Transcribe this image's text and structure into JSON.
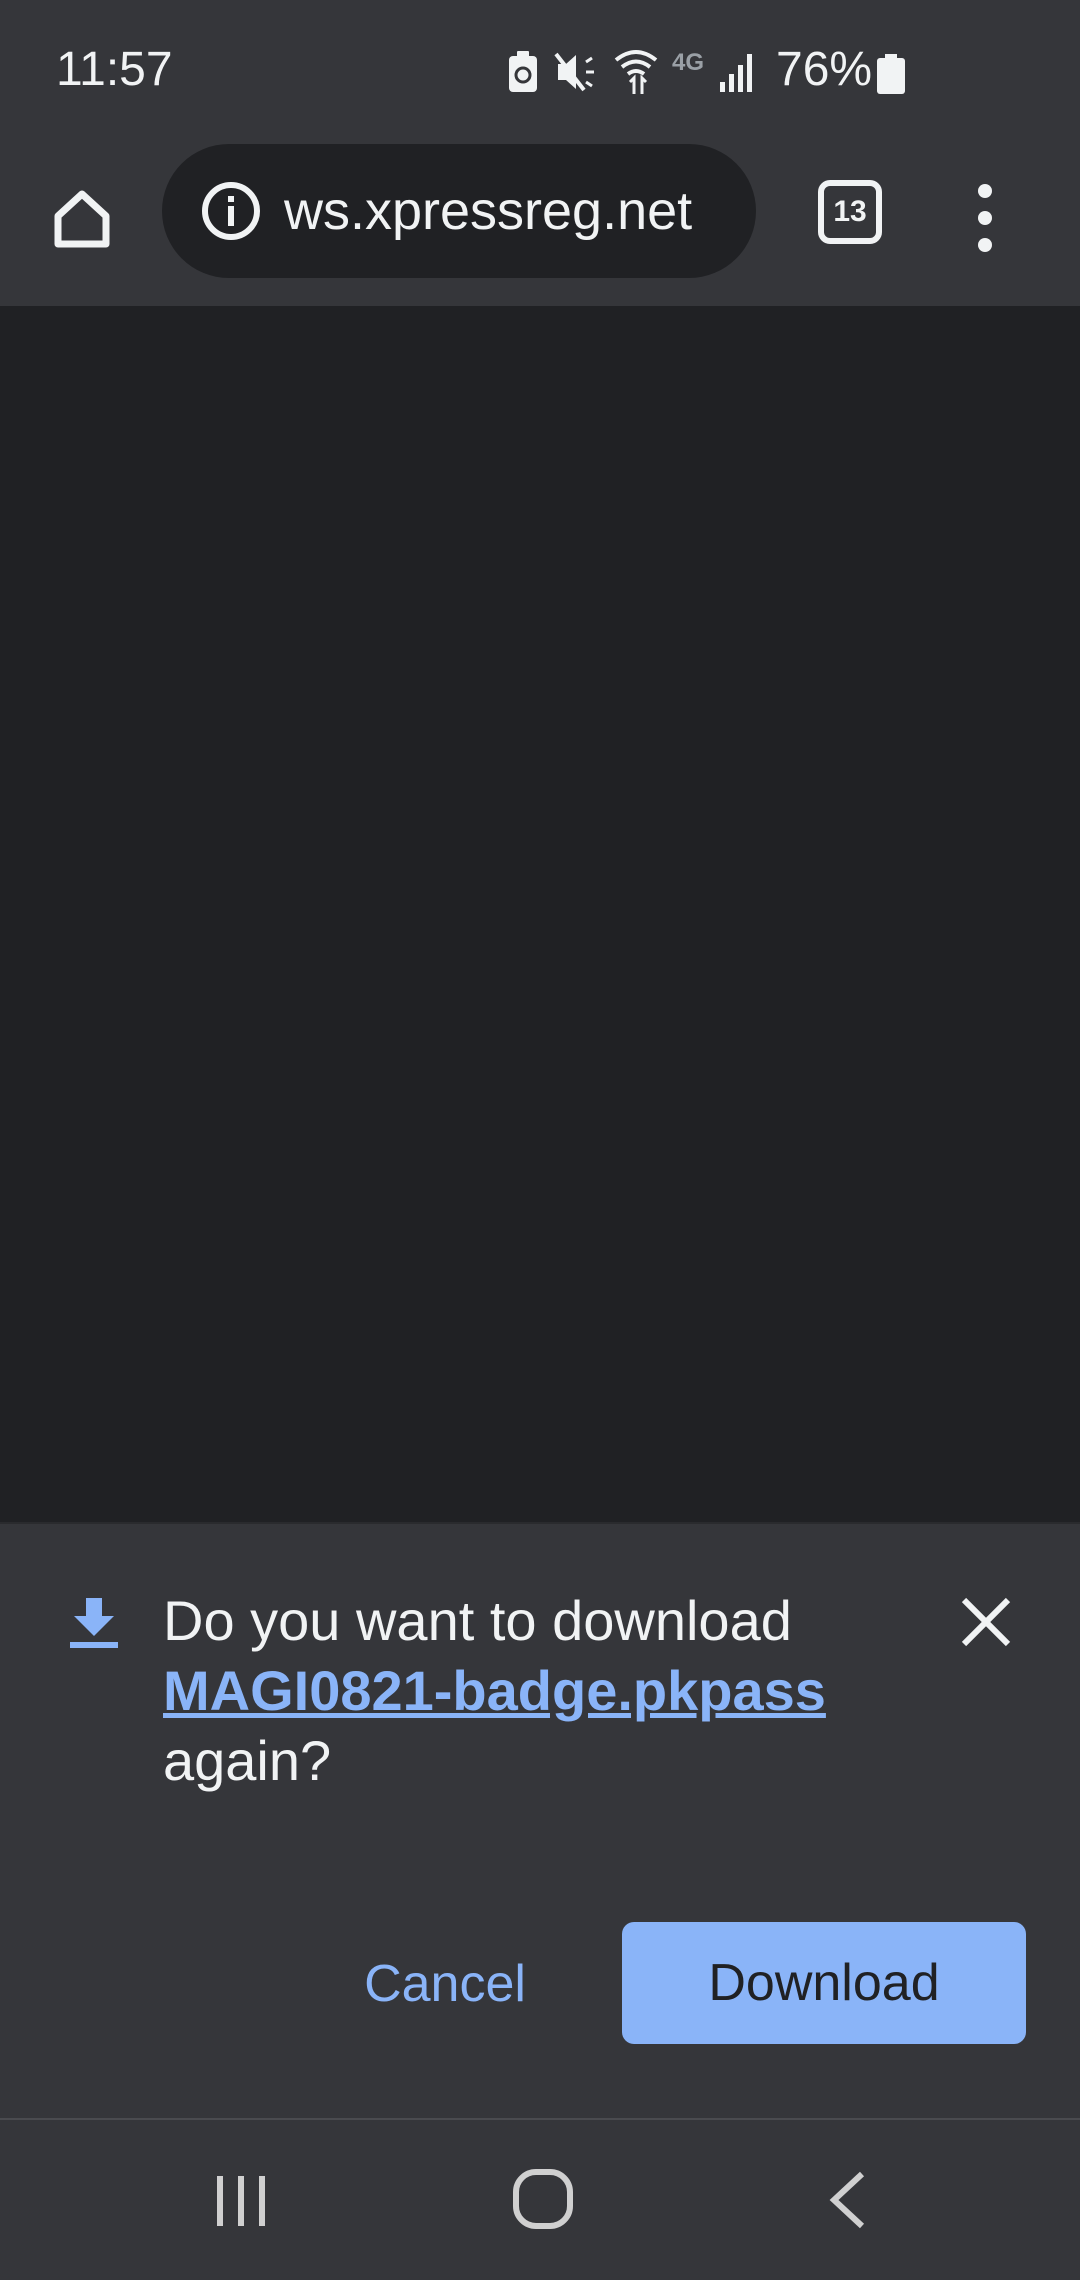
{
  "status_bar": {
    "time": "11:57",
    "network_label": "4G",
    "battery_percent": "76%",
    "icons": [
      "battery-saver-icon",
      "mute-icon",
      "wifi-icon",
      "4g-icon",
      "signal-icon",
      "battery-icon"
    ]
  },
  "toolbar": {
    "url": "ws.xpressreg.net",
    "tab_count": "13",
    "icons": [
      "home-icon",
      "info-icon",
      "tabs-icon",
      "more-menu-icon"
    ]
  },
  "download_prompt": {
    "message_prefix": "Do you want to download",
    "file_name": "MAGI0821-badge.pkpass",
    "message_suffix": "again?",
    "cancel_label": "Cancel",
    "download_label": "Download",
    "icons": [
      "download-icon",
      "close-icon"
    ]
  },
  "nav_bar": {
    "icons": [
      "recents-icon",
      "home-nav-icon",
      "back-icon"
    ]
  },
  "colors": {
    "accent": "#8ab4f8",
    "surface": "#35363a",
    "background": "#202124"
  }
}
